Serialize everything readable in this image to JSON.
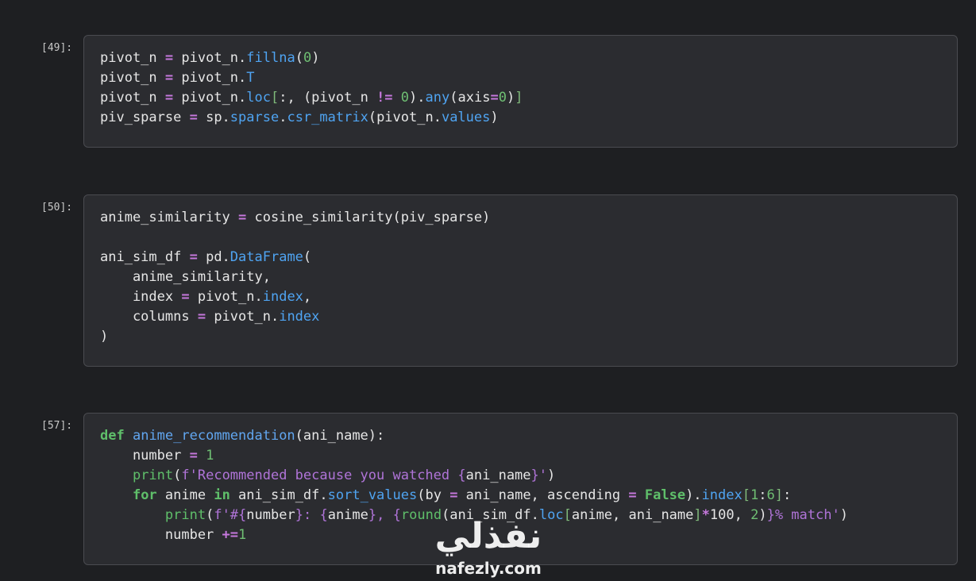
{
  "cells": [
    {
      "prompt": "[49]:",
      "lines": [
        [
          {
            "t": "pivot_n ",
            "c": ""
          },
          {
            "t": "=",
            "c": "op"
          },
          {
            "t": " pivot_n.",
            "c": ""
          },
          {
            "t": "fillna",
            "c": "attr"
          },
          {
            "t": "(",
            "c": ""
          },
          {
            "t": "0",
            "c": "num"
          },
          {
            "t": ")",
            "c": ""
          }
        ],
        [
          {
            "t": "pivot_n ",
            "c": ""
          },
          {
            "t": "=",
            "c": "op"
          },
          {
            "t": " pivot_n.",
            "c": ""
          },
          {
            "t": "T",
            "c": "attr"
          }
        ],
        [
          {
            "t": "pivot_n ",
            "c": ""
          },
          {
            "t": "=",
            "c": "op"
          },
          {
            "t": " pivot_n.",
            "c": ""
          },
          {
            "t": "loc",
            "c": "attr"
          },
          {
            "t": "[",
            "c": "br"
          },
          {
            "t": ":, (pivot_n ",
            "c": ""
          },
          {
            "t": "!=",
            "c": "op"
          },
          {
            "t": " ",
            "c": ""
          },
          {
            "t": "0",
            "c": "num"
          },
          {
            "t": ").",
            "c": ""
          },
          {
            "t": "any",
            "c": "attr"
          },
          {
            "t": "(axis",
            "c": ""
          },
          {
            "t": "=",
            "c": "op"
          },
          {
            "t": "0",
            "c": "num"
          },
          {
            "t": ")",
            "c": ""
          },
          {
            "t": "]",
            "c": "br"
          }
        ],
        [
          {
            "t": "piv_sparse ",
            "c": ""
          },
          {
            "t": "=",
            "c": "op"
          },
          {
            "t": " sp.",
            "c": ""
          },
          {
            "t": "sparse",
            "c": "attr"
          },
          {
            "t": ".",
            "c": ""
          },
          {
            "t": "csr_matrix",
            "c": "attr"
          },
          {
            "t": "(pivot_n.",
            "c": ""
          },
          {
            "t": "values",
            "c": "attr"
          },
          {
            "t": ")",
            "c": ""
          }
        ]
      ]
    },
    {
      "prompt": "[50]:",
      "lines": [
        [
          {
            "t": "anime_similarity ",
            "c": ""
          },
          {
            "t": "=",
            "c": "op"
          },
          {
            "t": " cosine_similarity(piv_sparse)",
            "c": ""
          }
        ],
        [],
        [
          {
            "t": "ani_sim_df ",
            "c": ""
          },
          {
            "t": "=",
            "c": "op"
          },
          {
            "t": " pd.",
            "c": ""
          },
          {
            "t": "DataFrame",
            "c": "attr"
          },
          {
            "t": "(",
            "c": ""
          }
        ],
        [
          {
            "t": "    anime_similarity,",
            "c": ""
          }
        ],
        [
          {
            "t": "    index ",
            "c": ""
          },
          {
            "t": "=",
            "c": "op"
          },
          {
            "t": " pivot_n.",
            "c": ""
          },
          {
            "t": "index",
            "c": "attr"
          },
          {
            "t": ",",
            "c": ""
          }
        ],
        [
          {
            "t": "    columns ",
            "c": ""
          },
          {
            "t": "=",
            "c": "op"
          },
          {
            "t": " pivot_n.",
            "c": ""
          },
          {
            "t": "index",
            "c": "attr"
          }
        ],
        [
          {
            "t": ")",
            "c": ""
          }
        ]
      ]
    },
    {
      "prompt": "[57]:",
      "lines": [
        [
          {
            "t": "def",
            "c": "kw"
          },
          {
            "t": " ",
            "c": ""
          },
          {
            "t": "anime_recommendation",
            "c": "fn"
          },
          {
            "t": "(ani_name):",
            "c": ""
          }
        ],
        [
          {
            "t": "    number ",
            "c": ""
          },
          {
            "t": "=",
            "c": "op"
          },
          {
            "t": " ",
            "c": ""
          },
          {
            "t": "1",
            "c": "num"
          }
        ],
        [
          {
            "t": "    ",
            "c": ""
          },
          {
            "t": "print",
            "c": "builtin"
          },
          {
            "t": "(",
            "c": ""
          },
          {
            "t": "f'Recommended because you watched ",
            "c": "str"
          },
          {
            "t": "{",
            "c": "str"
          },
          {
            "t": "ani_name",
            "c": ""
          },
          {
            "t": "}'",
            "c": "str"
          },
          {
            "t": ")",
            "c": ""
          }
        ],
        [
          {
            "t": "    ",
            "c": ""
          },
          {
            "t": "for",
            "c": "kw"
          },
          {
            "t": " anime ",
            "c": ""
          },
          {
            "t": "in",
            "c": "kw"
          },
          {
            "t": " ani_sim_df.",
            "c": ""
          },
          {
            "t": "sort_values",
            "c": "attr"
          },
          {
            "t": "(by ",
            "c": ""
          },
          {
            "t": "=",
            "c": "op"
          },
          {
            "t": " ani_name, ascending ",
            "c": ""
          },
          {
            "t": "=",
            "c": "op"
          },
          {
            "t": " ",
            "c": ""
          },
          {
            "t": "False",
            "c": "bool"
          },
          {
            "t": ").",
            "c": ""
          },
          {
            "t": "index",
            "c": "attr"
          },
          {
            "t": "[",
            "c": "br"
          },
          {
            "t": "1",
            "c": "num"
          },
          {
            "t": ":",
            "c": ""
          },
          {
            "t": "6",
            "c": "num"
          },
          {
            "t": "]",
            "c": "br"
          },
          {
            "t": ":",
            "c": ""
          }
        ],
        [
          {
            "t": "        ",
            "c": ""
          },
          {
            "t": "print",
            "c": "builtin"
          },
          {
            "t": "(",
            "c": ""
          },
          {
            "t": "f'#",
            "c": "str"
          },
          {
            "t": "{",
            "c": "str"
          },
          {
            "t": "number",
            "c": ""
          },
          {
            "t": "}",
            "c": "str"
          },
          {
            "t": ": ",
            "c": "str"
          },
          {
            "t": "{",
            "c": "str"
          },
          {
            "t": "anime",
            "c": ""
          },
          {
            "t": "}",
            "c": "str"
          },
          {
            "t": ", ",
            "c": "str"
          },
          {
            "t": "{",
            "c": "str"
          },
          {
            "t": "round",
            "c": "builtin"
          },
          {
            "t": "(ani_sim_df.",
            "c": ""
          },
          {
            "t": "loc",
            "c": "attr"
          },
          {
            "t": "[",
            "c": "br"
          },
          {
            "t": "anime, ani_name",
            "c": ""
          },
          {
            "t": "]",
            "c": "br"
          },
          {
            "t": "*",
            "c": "op"
          },
          {
            "t": "100, ",
            "c": ""
          },
          {
            "t": "2",
            "c": "num"
          },
          {
            "t": ")",
            "c": ""
          },
          {
            "t": "}",
            "c": "str"
          },
          {
            "t": "% match'",
            "c": "str"
          },
          {
            "t": ")",
            "c": ""
          }
        ],
        [
          {
            "t": "        number ",
            "c": ""
          },
          {
            "t": "+=",
            "c": "op"
          },
          {
            "t": "1",
            "c": "num"
          }
        ]
      ]
    }
  ],
  "watermark": {
    "arabic": "نفذلي",
    "latin": "nafezly.com"
  }
}
